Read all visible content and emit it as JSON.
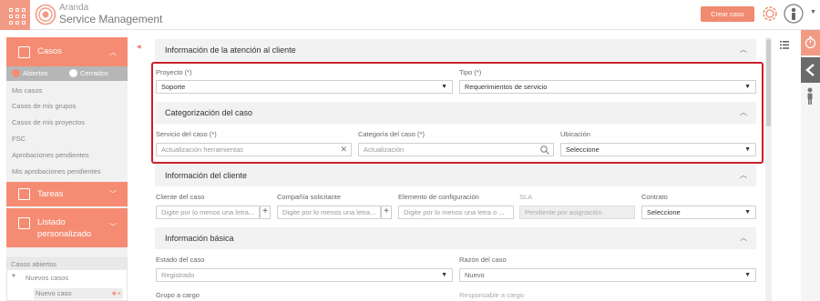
{
  "header": {
    "brand_line1": "Aranda",
    "brand_line2": "Service Management",
    "create_case_label": "Crear caso"
  },
  "sidebar": {
    "cases_label": "Casos",
    "tab_open": "Abiertos",
    "tab_closed": "Cerrados",
    "links": [
      "Mis casos",
      "Casos de mis grupos",
      "Casos de mis proyectos",
      "FSC",
      "Aprobaciones pendientes",
      "Mis aprobaciones pendientes"
    ],
    "tasks_label": "Tareas",
    "custom_list_label_1": "Listado",
    "custom_list_label_2": "personalizado",
    "open_cases_title": "Casos abiertos",
    "new_cases_label": "Nuevos casos",
    "new_case_item": "Nuevo caso",
    "new_case_badge": "★×"
  },
  "sections": {
    "attention": {
      "title": "Información de la atención al cliente",
      "project_label": "Proyecto (*)",
      "project_value": "Soporte",
      "type_label": "Tipo (*)",
      "type_value": "Requerimientos de servicio"
    },
    "categorization": {
      "title": "Categorización del caso",
      "service_label": "Servicio del caso (*)",
      "service_value": "Actualización herramientas",
      "category_label": "Categoría del caso (*)",
      "category_value": "Actualización",
      "location_label": "Ubicación",
      "location_value": "Seleccione"
    },
    "client": {
      "title": "Información del cliente",
      "client_label": "Cliente del caso",
      "client_placeholder": "Digite por lo menos una letra...",
      "company_label": "Compañía solicitante",
      "company_placeholder": "Digite por lo menos una letra...",
      "ci_label": "Elemento de configuración",
      "ci_placeholder": "Digite por lo menos una letra o ...",
      "sla_label": "SLA",
      "sla_value": "Pendiente por asignación",
      "contract_label": "Contrato",
      "contract_value": "Seleccione"
    },
    "basic": {
      "title": "Información básica",
      "state_label": "Estado del caso",
      "state_value": "Registrado",
      "reason_label": "Razón del caso",
      "reason_value": "Nuevo",
      "group_label": "Grupo a cargo",
      "responsible_label": "Responsable a cargo"
    }
  },
  "colors": {
    "accent": "#f58b72",
    "highlight": "#c9202a"
  }
}
